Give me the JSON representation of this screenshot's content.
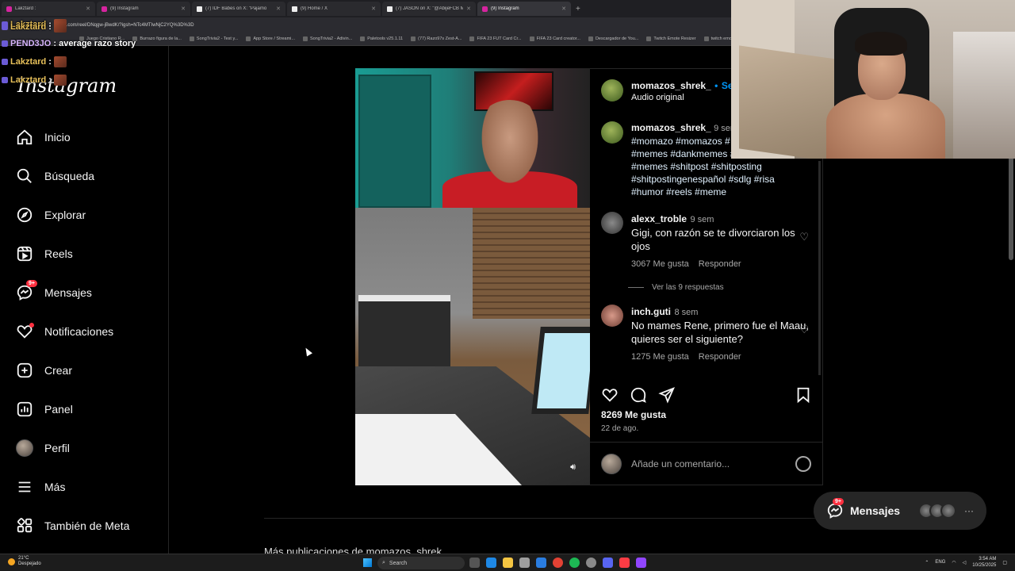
{
  "browser": {
    "tabs": [
      {
        "title": "Lakztard :",
        "type": "chat"
      },
      {
        "title": "(9) Instagram",
        "type": "ig"
      },
      {
        "title": "(7) IDF Babes on X: \"Pajamo",
        "type": "x"
      },
      {
        "title": "(9) Home / X",
        "type": "x"
      },
      {
        "title": "(7) JASON on X: \"@AbijeFCB Mi",
        "type": "x"
      },
      {
        "title": "(9) Instagram",
        "type": "ig",
        "active": true
      }
    ],
    "new_tab": "+",
    "url": "gram.com/reel/DNqgw-jBwdK/?igsh=NTc4MTIwNjC2YQ%3D%3D",
    "bookmarks": [
      "Juego Cristiano R...",
      "Burrazo figura de la...",
      "SongTrivia2 - Test y...",
      "App Store / Streami...",
      "SongTrivia2 - Adivin...",
      "Paletools v25.1.11",
      "(77) Razo97s Zest-A...",
      "FIFA 23 FUT Card Cr...",
      "FIFA 23 Card creator...",
      "Descargador de You...",
      "Twitch Emote Resizer",
      "twitch emote resiz..."
    ]
  },
  "chat": [
    {
      "user": "Lakztard",
      "text": ":",
      "color": "#e8c15a"
    },
    {
      "user": "Lakztard",
      "text": ":",
      "color": "#e8c15a"
    },
    {
      "user": "PEND3JO",
      "text": ": average razo story",
      "color": "#d9b6ff"
    },
    {
      "user": "Lakztard",
      "text": ":",
      "color": "#e8c15a"
    },
    {
      "user": "Lakztard",
      "text": ":",
      "color": "#e8c15a"
    }
  ],
  "sidebar": {
    "logo": "Instagram",
    "items": [
      {
        "label": "Inicio",
        "icon": "home-icon"
      },
      {
        "label": "Búsqueda",
        "icon": "search-icon"
      },
      {
        "label": "Explorar",
        "icon": "compass-icon"
      },
      {
        "label": "Reels",
        "icon": "reels-icon"
      },
      {
        "label": "Mensajes",
        "icon": "messenger-icon",
        "badge": "9+"
      },
      {
        "label": "Notificaciones",
        "icon": "heart-icon"
      },
      {
        "label": "Crear",
        "icon": "plus-square-icon"
      },
      {
        "label": "Panel",
        "icon": "chart-icon"
      },
      {
        "label": "Perfil",
        "icon": "avatar"
      },
      {
        "label": "Más",
        "icon": "menu-icon"
      },
      {
        "label": "También de Meta",
        "icon": "meta-grid-icon"
      }
    ]
  },
  "post": {
    "username": "momazos_shrek_",
    "follow_sep": "•",
    "follow": "Seg",
    "audio": "Audio original",
    "caption_user": "momazos_shrek_",
    "caption_time": "9 sem",
    "caption_lines": [
      "#momazo #momazos #",
      "#memes #dankmemes #",
      "#memes #shitpost #shitposting",
      "#shitpostingenespañol #sdlg #risa",
      "#humor #reels #meme"
    ],
    "comments": [
      {
        "user": "alexx_troble",
        "time": "9 sem",
        "text": "Gigi, con razón se te divorciaron los ojos",
        "likes": "3067 Me gusta",
        "reply": "Responder"
      },
      {
        "user": "inch.guti",
        "time": "8 sem",
        "text": "No mames Rene, primero fue el Maau, quieres ser el siguiente?",
        "likes": "1275 Me gusta",
        "reply": "Responder"
      }
    ],
    "view_replies": "Ver las 9 respuestas",
    "likes": "8269 Me gusta",
    "date": "22 de ago.",
    "comment_placeholder": "Añade un comentario...",
    "more_text": "Más publicaciones de momazos_shrek_"
  },
  "messages_pill": {
    "label": "Mensajes",
    "badge": "9+"
  },
  "taskbar": {
    "temp": "21°C",
    "weather": "Despejado",
    "search": "Search",
    "lang": "ENG",
    "time": "3:54 AM",
    "date": "10/25/2025"
  },
  "colors": {
    "accent": "#0095f6",
    "badge": "#ff3040",
    "bg": "#000000"
  }
}
